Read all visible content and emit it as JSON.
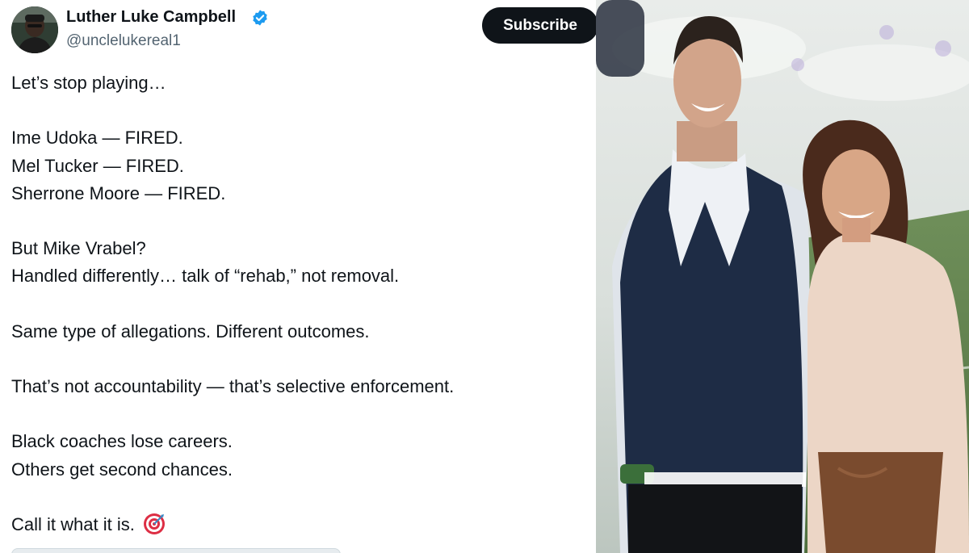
{
  "author": {
    "name": "Luther Luke Campbell",
    "handle": "@unclelukereal1",
    "verified_color": "#1d9bf0",
    "avatar_icon": "avatar-photo"
  },
  "subscribe": {
    "label": "Subscribe"
  },
  "tweet": {
    "lines": [
      "Let’s stop playing…",
      "",
      "Ime Udoka — FIRED.",
      "Mel Tucker — FIRED.",
      "Sherrone Moore — FIRED.",
      "",
      "But Mike Vrabel?",
      "Handled differently… talk of “rehab,” not removal.",
      "",
      "Same type of allegations. Different outcomes.",
      "",
      "That’s not accountability — that’s selective enforcement.",
      "",
      "Black coaches lose careers.",
      "Others get second chances.",
      "",
      "Call it what it is."
    ],
    "emoji": "direct-hit-target-icon"
  },
  "colors": {
    "text": "#0f1419",
    "secondary": "#536471",
    "button": "#0f1419"
  }
}
